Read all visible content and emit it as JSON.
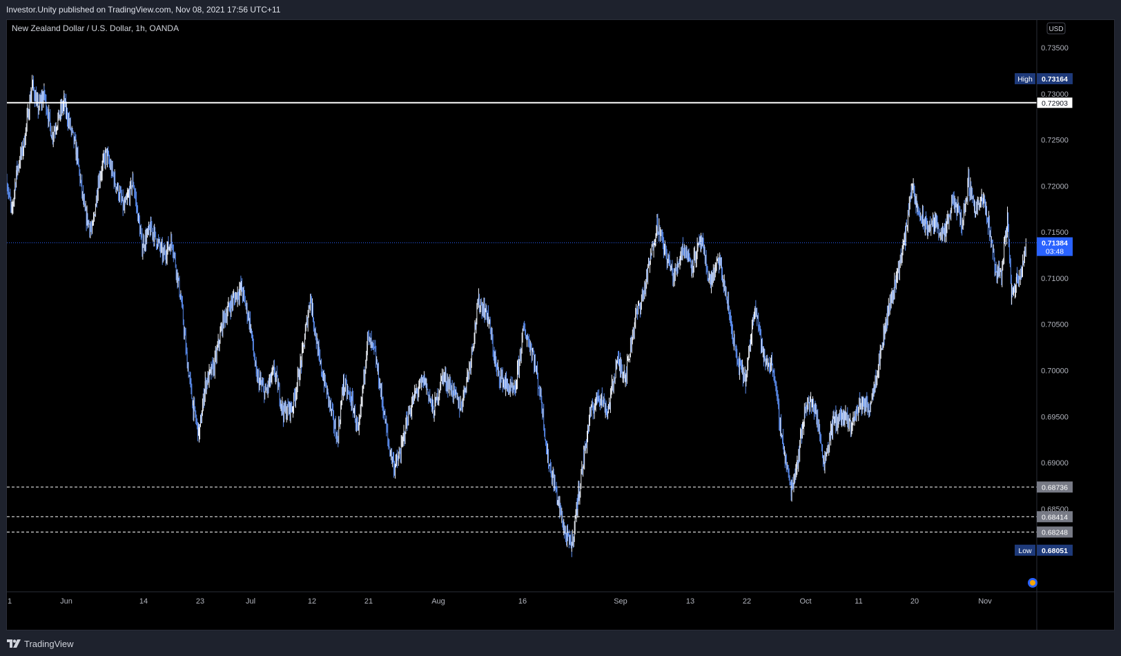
{
  "publish_info": "Investor.Unity published on TradingView.com, Nov 08, 2021 17:56 UTC+11",
  "symbol_title": "New Zealand Dollar / U.S. Dollar, 1h, OANDA",
  "currency_button": "USD",
  "logo_text": "TradingView",
  "colors": {
    "background": "#000000",
    "frame": "#1e222d",
    "candles": "#5b8def",
    "current_price": "#2962ff",
    "high_low_badge": "#1e3a7a"
  },
  "chart_data": {
    "type": "line",
    "title": "New Zealand Dollar / U.S. Dollar, 1h, OANDA",
    "grid": false,
    "ylim": [
      0.676,
      0.738
    ],
    "y_ticks": [
      "0.73500",
      "0.73000",
      "0.72500",
      "0.72000",
      "0.71500",
      "0.71000",
      "0.70500",
      "0.70000",
      "0.69500",
      "0.69000",
      "0.68500"
    ],
    "x_ticks": [
      {
        "label": "1",
        "x": 0
      },
      {
        "label": "Jun",
        "x": 1
      },
      {
        "label": "14",
        "x": 2
      },
      {
        "label": "23",
        "x": 3
      },
      {
        "label": "Jul",
        "x": 4
      },
      {
        "label": "12",
        "x": 5
      },
      {
        "label": "21",
        "x": 6
      },
      {
        "label": "Aug",
        "x": 7
      },
      {
        "label": "16",
        "x": 8
      },
      {
        "label": "Sep",
        "x": 9
      },
      {
        "label": "13",
        "x": 10
      },
      {
        "label": "22",
        "x": 11
      },
      {
        "label": "Oct",
        "x": 12
      },
      {
        "label": "11",
        "x": 13
      },
      {
        "label": "20",
        "x": 14
      },
      {
        "label": "Nov",
        "x": 15
      }
    ],
    "series": [
      {
        "values": [
          [
            0.0,
            0.7205
          ],
          [
            0.08,
            0.717
          ],
          [
            0.16,
            0.7215
          ],
          [
            0.28,
            0.7245
          ],
          [
            0.42,
            0.731
          ],
          [
            0.52,
            0.7285
          ],
          [
            0.62,
            0.73
          ],
          [
            0.75,
            0.7255
          ],
          [
            0.95,
            0.729
          ],
          [
            1.15,
            0.724
          ],
          [
            1.3,
            0.717
          ],
          [
            1.42,
            0.715
          ],
          [
            1.52,
            0.7205
          ],
          [
            1.65,
            0.7235
          ],
          [
            1.8,
            0.7205
          ],
          [
            1.95,
            0.7175
          ],
          [
            2.1,
            0.7205
          ],
          [
            2.25,
            0.7135
          ],
          [
            2.4,
            0.7155
          ],
          [
            2.6,
            0.7125
          ],
          [
            2.75,
            0.714
          ],
          [
            2.9,
            0.7075
          ],
          [
            3.0,
            0.701
          ],
          [
            3.1,
            0.696
          ],
          [
            3.2,
            0.693
          ],
          [
            3.3,
            0.6985
          ],
          [
            3.45,
            0.7005
          ],
          [
            3.6,
            0.7055
          ],
          [
            3.75,
            0.7075
          ],
          [
            3.9,
            0.709
          ],
          [
            4.05,
            0.705
          ],
          [
            4.15,
            0.6995
          ],
          [
            4.3,
            0.6975
          ],
          [
            4.45,
            0.7
          ],
          [
            4.6,
            0.6955
          ],
          [
            4.75,
            0.696
          ],
          [
            4.9,
            0.701
          ],
          [
            5.05,
            0.708
          ],
          [
            5.2,
            0.701
          ],
          [
            5.35,
            0.697
          ],
          [
            5.5,
            0.6925
          ],
          [
            5.6,
            0.6985
          ],
          [
            5.75,
            0.6965
          ],
          [
            5.85,
            0.693
          ],
          [
            6.0,
            0.7035
          ],
          [
            6.12,
            0.702
          ],
          [
            6.25,
            0.6965
          ],
          [
            6.35,
            0.692
          ],
          [
            6.45,
            0.6895
          ],
          [
            6.55,
            0.691
          ],
          [
            6.65,
            0.6945
          ],
          [
            6.8,
            0.6975
          ],
          [
            6.95,
            0.699
          ],
          [
            7.1,
            0.6955
          ],
          [
            7.25,
            0.6995
          ],
          [
            7.4,
            0.698
          ],
          [
            7.55,
            0.696
          ],
          [
            7.7,
            0.7005
          ],
          [
            7.85,
            0.7075
          ],
          [
            8.0,
            0.706
          ],
          [
            8.15,
            0.7
          ],
          [
            8.3,
            0.6985
          ],
          [
            8.45,
            0.6975
          ],
          [
            8.6,
            0.7045
          ],
          [
            8.75,
            0.702
          ],
          [
            8.9,
            0.6965
          ],
          [
            9.0,
            0.6905
          ],
          [
            9.1,
            0.688
          ],
          [
            9.2,
            0.685
          ],
          [
            9.3,
            0.682
          ],
          [
            9.4,
            0.681
          ],
          [
            9.5,
            0.686
          ],
          [
            9.6,
            0.6905
          ],
          [
            9.7,
            0.695
          ],
          [
            9.85,
            0.6975
          ],
          [
            10.0,
            0.6955
          ],
          [
            10.15,
            0.701
          ],
          [
            10.3,
            0.6995
          ],
          [
            10.45,
            0.7055
          ],
          [
            10.6,
            0.7085
          ],
          [
            10.72,
            0.7125
          ],
          [
            10.82,
            0.716
          ],
          [
            10.95,
            0.713
          ],
          [
            11.1,
            0.71
          ],
          [
            11.25,
            0.7135
          ],
          [
            11.4,
            0.7115
          ],
          [
            11.55,
            0.714
          ],
          [
            11.7,
            0.7095
          ],
          [
            11.85,
            0.712
          ],
          [
            12.0,
            0.707
          ],
          [
            12.15,
            0.701
          ],
          [
            12.3,
            0.699
          ],
          [
            12.45,
            0.7075
          ],
          [
            12.6,
            0.701
          ],
          [
            12.75,
            0.7005
          ],
          [
            12.85,
            0.695
          ],
          [
            12.95,
            0.6905
          ],
          [
            13.05,
            0.687
          ],
          [
            13.15,
            0.69
          ],
          [
            13.3,
            0.6965
          ],
          [
            13.45,
            0.696
          ],
          [
            13.6,
            0.69
          ],
          [
            13.75,
            0.6945
          ],
          [
            13.9,
            0.695
          ],
          [
            14.05,
            0.694
          ],
          [
            14.2,
            0.6965
          ],
          [
            14.35,
            0.696
          ],
          [
            14.5,
            0.7005
          ],
          [
            14.65,
            0.706
          ],
          [
            14.8,
            0.71
          ],
          [
            14.95,
            0.7145
          ],
          [
            15.05,
            0.72
          ],
          [
            15.15,
            0.7175
          ],
          [
            15.3,
            0.7155
          ],
          [
            15.45,
            0.716
          ],
          [
            15.6,
            0.7145
          ],
          [
            15.75,
            0.7185
          ],
          [
            15.9,
            0.716
          ],
          [
            16.0,
            0.7205
          ],
          [
            16.12,
            0.7175
          ],
          [
            16.25,
            0.7185
          ],
          [
            16.35,
            0.7155
          ],
          [
            16.45,
            0.711
          ],
          [
            16.55,
            0.7105
          ],
          [
            16.65,
            0.7165
          ],
          [
            16.72,
            0.708
          ],
          [
            16.8,
            0.7098
          ],
          [
            16.88,
            0.711
          ],
          [
            16.96,
            0.7138
          ]
        ]
      }
    ],
    "horizontal_lines": [
      {
        "value": "0.72903",
        "style": "solid"
      },
      {
        "value": "0.68736",
        "style": "dashed"
      },
      {
        "value": "0.68414",
        "style": "dashed"
      },
      {
        "value": "0.68248",
        "style": "dashed"
      }
    ],
    "high": {
      "label": "High",
      "value": "0.73164"
    },
    "low": {
      "label": "Low",
      "value": "0.68051"
    },
    "current_price": {
      "value": "0.71384",
      "countdown": "03:48"
    }
  }
}
